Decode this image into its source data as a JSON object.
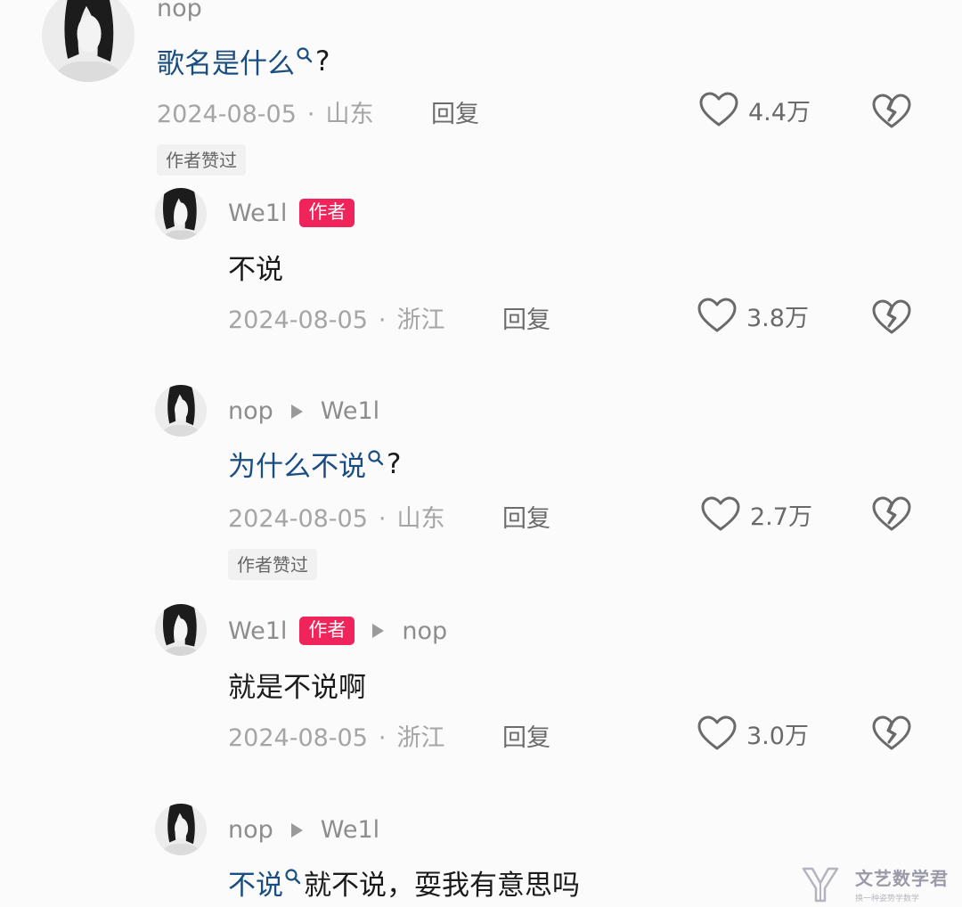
{
  "comments": [
    {
      "user": "nop",
      "text_link": "歌名是什么",
      "text_rest": "?",
      "date": "2024-08-05",
      "location": "山东",
      "reply_label": "回复",
      "likes": "4.4万",
      "liked_by_author": "作者赞过"
    },
    {
      "user": "We1l",
      "badge": "作者",
      "text": "不说",
      "date": "2024-08-05",
      "location": "浙江",
      "reply_label": "回复",
      "likes": "3.8万"
    },
    {
      "user": "nop",
      "reply_to": "We1l",
      "text_link": "为什么不说",
      "text_rest": "?",
      "date": "2024-08-05",
      "location": "山东",
      "reply_label": "回复",
      "likes": "2.7万",
      "liked_by_author": "作者赞过"
    },
    {
      "user": "We1l",
      "badge": "作者",
      "reply_to": "nop",
      "text": "就是不说啊",
      "date": "2024-08-05",
      "location": "浙江",
      "reply_label": "回复",
      "likes": "3.0万"
    },
    {
      "user": "nop",
      "reply_to": "We1l",
      "text_link": "不说",
      "text_rest": "就不说，耍我有意思吗"
    }
  ],
  "watermark": {
    "title": "文艺数学君",
    "subtitle": "换一种姿势学数学"
  },
  "colors": {
    "link": "#1a4e82",
    "badge": "#f0245a",
    "meta": "#a5a5a5"
  },
  "icons": {
    "like": "heart-outline-icon",
    "dislike": "broken-heart-icon",
    "search": "search-icon",
    "reply_arrow": "play-triangle-icon"
  }
}
